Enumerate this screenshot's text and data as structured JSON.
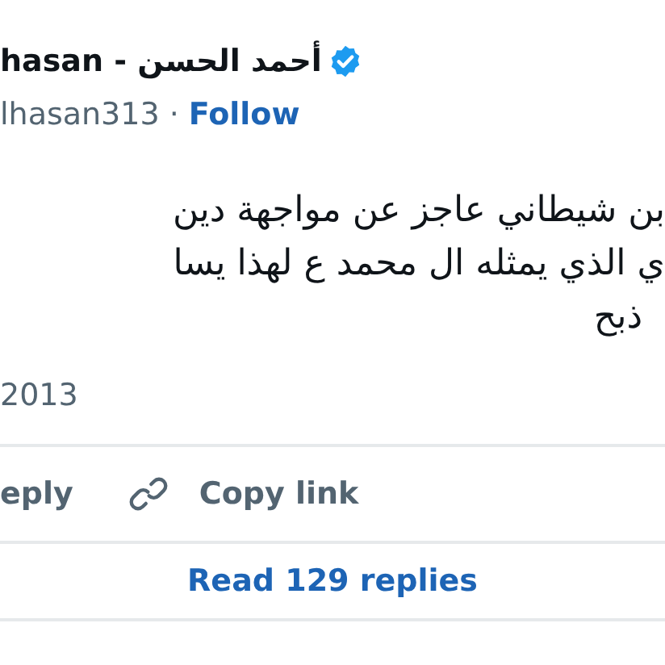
{
  "author": {
    "display_name": "hasan - أحمد الحسن",
    "verified": true,
    "handle": "lhasan313",
    "separator": "·",
    "follow": "Follow"
  },
  "tweet": {
    "lines": [
      "بن شيطاني عاجز عن مواجهة دين",
      "ي الذي يمثله ال محمد ع لهذا يسا",
      "ذبح"
    ]
  },
  "date": "2013",
  "reply_button": {
    "label": "eply"
  },
  "copy_link_button": {
    "label": "Copy link"
  },
  "replies_button": "Read 129 replies"
}
